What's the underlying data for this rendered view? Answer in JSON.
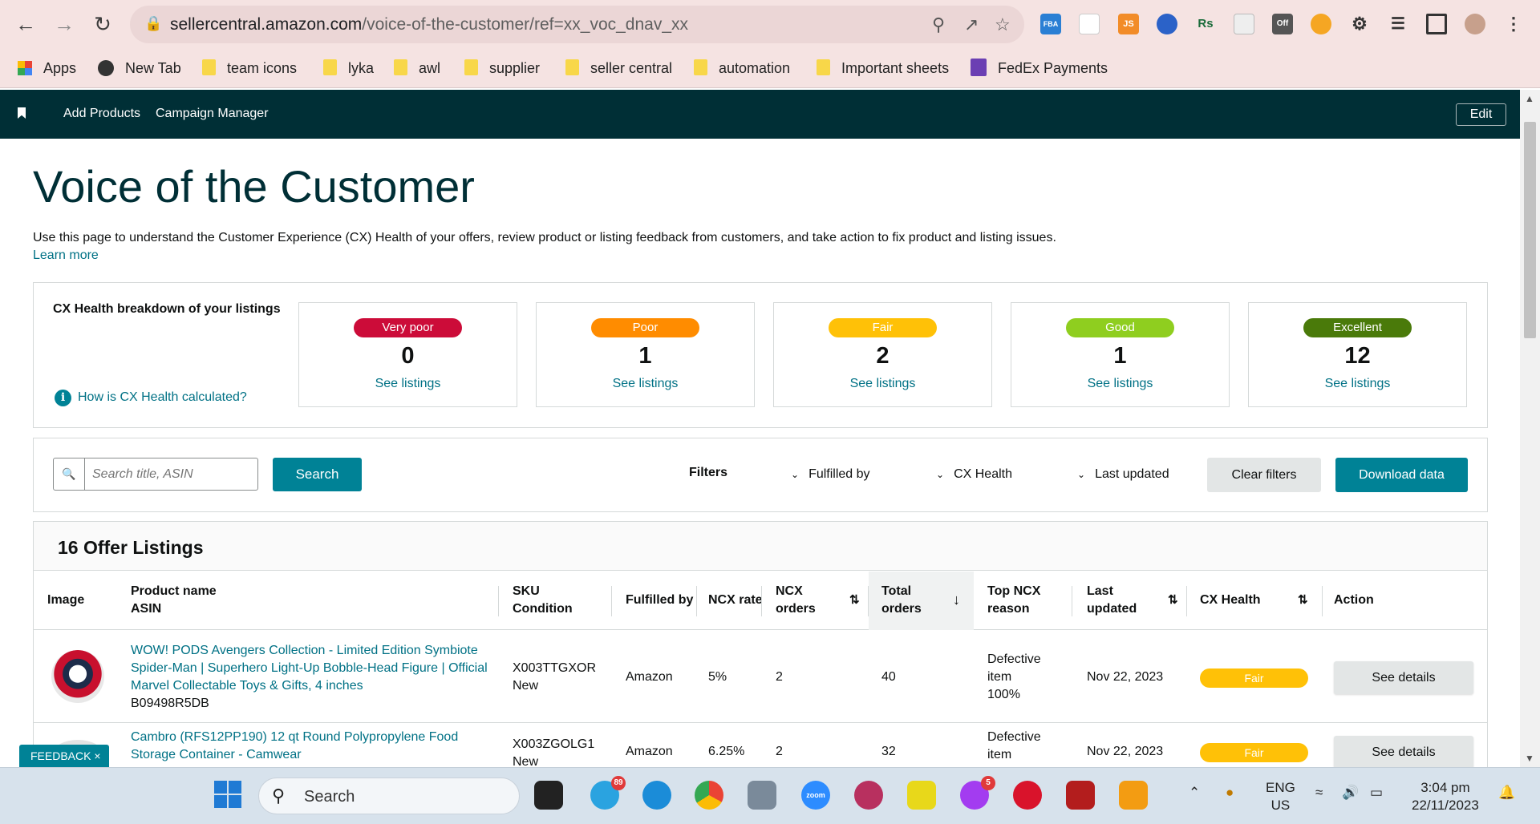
{
  "browser": {
    "url_host": "sellercentral.amazon.com",
    "url_path": "/voice-of-the-customer/ref=xx_voc_dnav_xx",
    "ext_fba": "FBA",
    "ext_js": "JS",
    "ext_rs": "Rs",
    "ext_off": "Off",
    "bookmarks": [
      "Apps",
      "New Tab",
      "team icons",
      "lyka",
      "awl",
      "supplier",
      "seller central",
      "automation",
      "Important sheets",
      "FedEx Payments"
    ]
  },
  "sc_nav": {
    "links": [
      "Add Products",
      "Campaign Manager"
    ],
    "edit": "Edit"
  },
  "page": {
    "title": "Voice of the Customer",
    "description": "Use this page to understand the Customer Experience (CX) Health of your offers, review product or listing feedback from customers, and take action to fix product and listing issues.",
    "learn_more": "Learn more"
  },
  "cx_health": {
    "heading": "CX Health breakdown of your listings",
    "how_link": "How is CX Health calculated?",
    "info_glyph": "i",
    "cards": [
      {
        "label": "Very poor",
        "count": "0",
        "link": "See listings",
        "color": "#cc0c39"
      },
      {
        "label": "Poor",
        "count": "1",
        "link": "See listings",
        "color": "#ff8c00"
      },
      {
        "label": "Fair",
        "count": "2",
        "link": "See listings",
        "color": "#ffc107"
      },
      {
        "label": "Good",
        "count": "1",
        "link": "See listings",
        "color": "#8fce1f"
      },
      {
        "label": "Excellent",
        "count": "12",
        "link": "See listings",
        "color": "#4a7a0a"
      }
    ]
  },
  "filters": {
    "search_placeholder": "Search title, ASIN",
    "search_button": "Search",
    "label": "Filters",
    "dropdowns": [
      "Fulfilled by",
      "CX Health",
      "Last updated"
    ],
    "clear": "Clear filters",
    "download": "Download data"
  },
  "listings": {
    "title": "16 Offer Listings",
    "headers": {
      "image": "Image",
      "product_name": "Product name",
      "asin": "ASIN",
      "sku": "SKU",
      "condition": "Condition",
      "fulfilled_by": "Fulfilled by",
      "ncx_rate": "NCX rate",
      "ncx_orders_1": "NCX",
      "ncx_orders_2": "orders",
      "total_orders_1": "Total",
      "total_orders_2": "orders",
      "top_ncx_1": "Top NCX",
      "top_ncx_2": "reason",
      "last_updated_1": "Last",
      "last_updated_2": "updated",
      "cx_health": "CX Health",
      "action": "Action"
    },
    "rows": [
      {
        "product_name": "WOW! PODS Avengers Collection - Limited Edition Symbiote Spider-Man | Superhero Light-Up Bobble-Head Figure | Official Marvel Collectable Toys & Gifts, 4 inches",
        "asin": "B09498R5DB",
        "sku": "X003TTGXOR",
        "condition": "New",
        "fulfilled_by": "Amazon",
        "ncx_rate": "5%",
        "ncx_orders": "2",
        "total_orders": "40",
        "top_ncx_1": "Defective",
        "top_ncx_2": "item",
        "top_ncx_3": "100%",
        "last_updated": "Nov 22, 2023",
        "cx_health": "Fair",
        "action": "See details"
      },
      {
        "product_name": "Cambro (RFS12PP190) 12 qt Round Polypropylene Food Storage Container - Camwear",
        "asin": "",
        "sku": "X003ZGOLG1",
        "condition": "New",
        "fulfilled_by": "Amazon",
        "ncx_rate": "6.25%",
        "ncx_orders": "2",
        "total_orders": "32",
        "top_ncx_1": "Defective",
        "top_ncx_2": "item",
        "top_ncx_3": "",
        "last_updated": "Nov 22, 2023",
        "cx_health": "Fair",
        "action": "See details"
      }
    ]
  },
  "feedback": {
    "label": "FEEDBACK",
    "close": "×"
  },
  "taskbar": {
    "search": "Search",
    "telegram_badge": "89",
    "messenger_badge": "5",
    "zoom_label": "zoom",
    "lang_1": "ENG",
    "lang_2": "US",
    "time": "3:04 pm",
    "date": "22/11/2023"
  }
}
